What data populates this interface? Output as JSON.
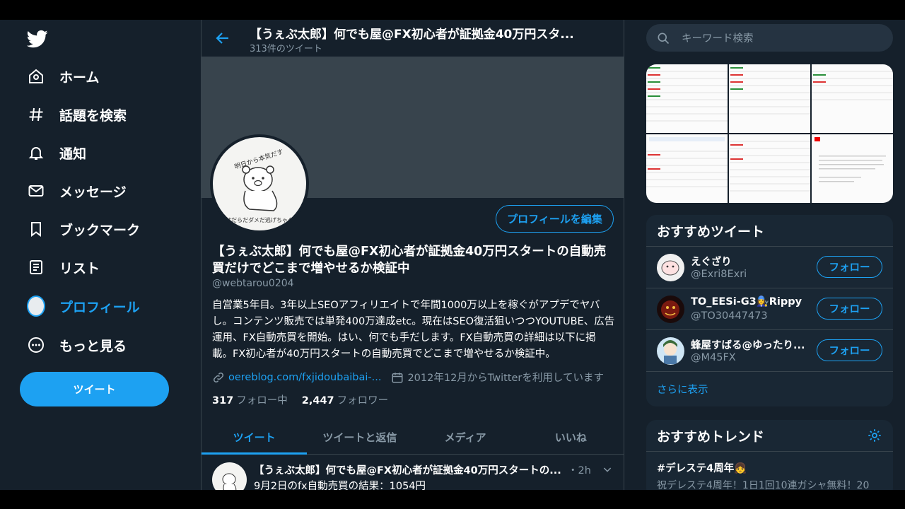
{
  "nav": {
    "items": [
      {
        "label": "ホーム",
        "icon": "home-icon"
      },
      {
        "label": "話題を検索",
        "icon": "hashtag-icon"
      },
      {
        "label": "通知",
        "icon": "bell-icon"
      },
      {
        "label": "メッセージ",
        "icon": "mail-icon"
      },
      {
        "label": "ブックマーク",
        "icon": "bookmark-icon"
      },
      {
        "label": "リスト",
        "icon": "list-icon"
      },
      {
        "label": "プロフィール",
        "icon": "avatar"
      },
      {
        "label": "もっと見る",
        "icon": "more-icon"
      }
    ],
    "tweet_button": "ツイート"
  },
  "header": {
    "title": "【うぇぶ太郎】何でも屋@FX初心者が証拠金40万円スタ...",
    "subtitle": "313件のツイート"
  },
  "profile": {
    "edit_button": "プロフィールを編集",
    "name": "【うぇぶ太郎】何でも屋@FX初心者が証拠金40万円スタートの自動売買だけでどこまで増やせるか検証中",
    "handle": "@webtarou0204",
    "bio": "自営業5年目。3年以上SEOアフィリエイトで年間1000万以上を稼ぐがアプデでヤバし。コンテンツ販売では単発400万達成etc。現在はSEO復活狙いつつYOUTUBE、広告運用、FX自動売買を開始。はい、何でも手だします。FX自動売買の詳細は以下に掲載。FX初心者が40万円スタートの自動売買でどこまで増やせるか検証中。",
    "link": "oereblog.com/fxjidoubaibai-...",
    "joined": "2012年12月からTwitterを利用しています",
    "following_count": "317",
    "following_label": "フォロー中",
    "followers_count": "2,447",
    "followers_label": "フォロワー",
    "avatar_text_top": "明日から本気だす",
    "avatar_text_bottom": "今日はだらだダメだ逃げちゃダメだ"
  },
  "tabs": [
    "ツイート",
    "ツイートと返信",
    "メディア",
    "いいね"
  ],
  "tweet": {
    "name": "【うぇぶ太郎】何でも屋@FX初心者が証拠金40万円スタートの...",
    "time": "・2h",
    "text": "9月2日のfx自動売買の結果：1054円"
  },
  "search": {
    "placeholder": "キーワード検索"
  },
  "recommend": {
    "title": "おすすめツイート",
    "follow_label": "フォロー",
    "users": [
      {
        "name": "えぐざり",
        "handle": "@Exri8Exri"
      },
      {
        "name": "TO_EESi-G3👩‍🔧Rippy",
        "handle": "@TO30447473"
      },
      {
        "name": "蜂屋すばる@ゆったり...",
        "handle": "@M45FX"
      }
    ],
    "more": "さらに表示"
  },
  "trends": {
    "title": "おすすめトレンド",
    "items": [
      {
        "name": "#デレステ4周年👧",
        "sub": "祝デレステ4周年！1日1回10連ガシャ無料！20"
      }
    ]
  },
  "colors": {
    "accent": "#1da1f2",
    "background": "#15202b",
    "card": "#192734",
    "muted": "#8899a6"
  }
}
